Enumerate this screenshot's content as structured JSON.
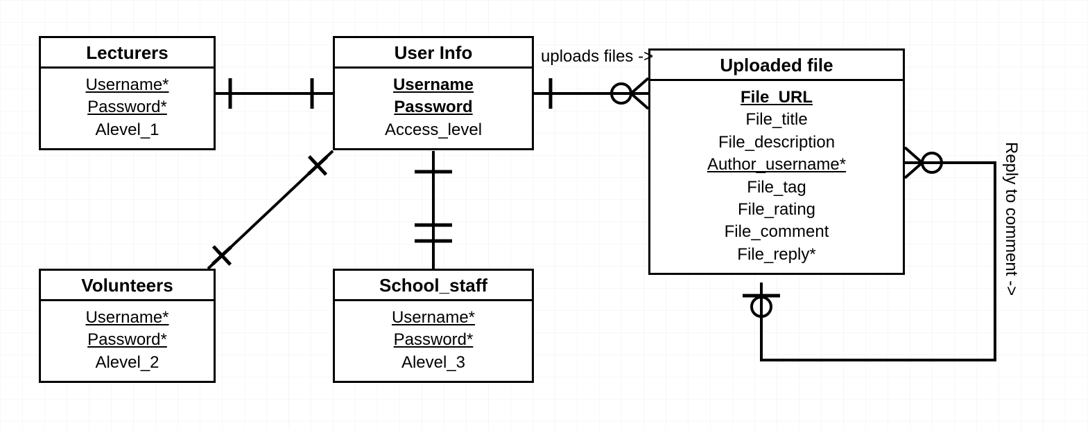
{
  "entities": {
    "lecturers": {
      "title": "Lecturers",
      "attrs": [
        {
          "text": "Username*",
          "u": true,
          "b": false
        },
        {
          "text": "Password*",
          "u": true,
          "b": false
        },
        {
          "text": "Alevel_1",
          "u": false,
          "b": false
        }
      ]
    },
    "userinfo": {
      "title": "User Info",
      "attrs": [
        {
          "text": "Username",
          "u": true,
          "b": true
        },
        {
          "text": "Password",
          "u": true,
          "b": true
        },
        {
          "text": "Access_level",
          "u": false,
          "b": false
        }
      ]
    },
    "uploaded": {
      "title": "Uploaded file",
      "attrs": [
        {
          "text": "File_URL",
          "u": true,
          "b": true
        },
        {
          "text": "File_title",
          "u": false,
          "b": false
        },
        {
          "text": "File_description",
          "u": false,
          "b": false
        },
        {
          "text": "Author_username*",
          "u": true,
          "b": false
        },
        {
          "text": "File_tag",
          "u": false,
          "b": false
        },
        {
          "text": "File_rating",
          "u": false,
          "b": false
        },
        {
          "text": "File_comment",
          "u": false,
          "b": false
        },
        {
          "text": "File_reply*",
          "u": false,
          "b": false
        }
      ]
    },
    "volunteers": {
      "title": "Volunteers",
      "attrs": [
        {
          "text": "Username*",
          "u": true,
          "b": false
        },
        {
          "text": "Password*",
          "u": true,
          "b": false
        },
        {
          "text": "Alevel_2",
          "u": false,
          "b": false
        }
      ]
    },
    "schoolstaff": {
      "title": "School_staff",
      "attrs": [
        {
          "text": "Username*",
          "u": true,
          "b": false
        },
        {
          "text": "Password*",
          "u": true,
          "b": false
        },
        {
          "text": "Alevel_3",
          "u": false,
          "b": false
        }
      ]
    }
  },
  "labels": {
    "uploads": "uploads files ->",
    "reply": "Reply to\ncomment ->"
  }
}
